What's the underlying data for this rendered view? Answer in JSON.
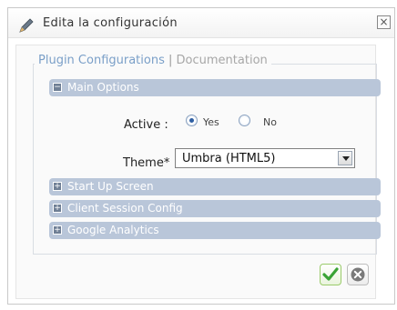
{
  "window": {
    "title": "Edita la configuración",
    "close_icon": "close-icon"
  },
  "tabs": {
    "active": "Plugin Configurations",
    "separator": "|",
    "other": "Documentation"
  },
  "sections": [
    {
      "label": "Main Options",
      "expanded": true,
      "toggle": "−"
    },
    {
      "label": "Start Up Screen",
      "expanded": false,
      "toggle": "+"
    },
    {
      "label": "Client Session Config",
      "expanded": false,
      "toggle": "+"
    },
    {
      "label": "Google Analytics",
      "expanded": false,
      "toggle": "+"
    }
  ],
  "main_options": {
    "active_label": "Active :",
    "active_yes": "Yes",
    "active_no": "No",
    "active_value": "Yes",
    "theme_label": "Theme* :",
    "theme_value": "Umbra (HTML5)"
  },
  "buttons": {
    "ok_icon": "checkmark-icon",
    "cancel_icon": "cancel-icon"
  },
  "colors": {
    "section_bg": "#b9c6d9",
    "tab_active": "#7a9fc8",
    "ok_green": "#39a335"
  }
}
